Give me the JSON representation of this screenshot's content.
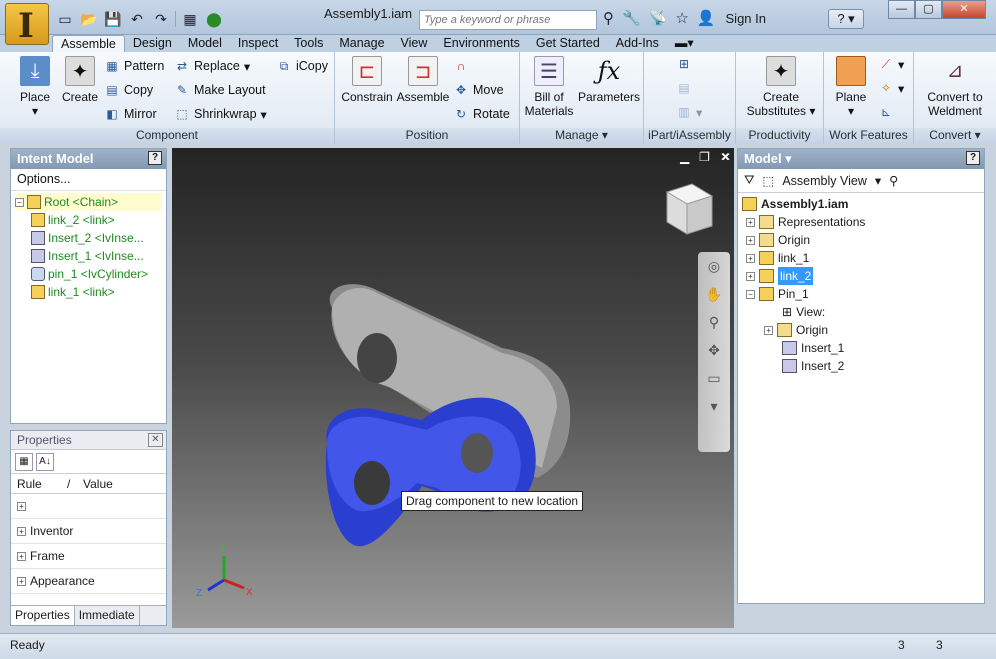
{
  "window": {
    "title": "Assembly1.iam",
    "search_placeholder": "Type a keyword or phrase",
    "sign_in": "Sign In",
    "help": "?"
  },
  "app_button": {
    "letter": "I"
  },
  "tabs": [
    "Assemble",
    "Design",
    "Model",
    "Inspect",
    "Tools",
    "Manage",
    "View",
    "Environments",
    "Get Started",
    "Add-Ins"
  ],
  "ribbon": {
    "component": {
      "label": "Component",
      "place": "Place",
      "create": "Create",
      "pattern": "Pattern",
      "copy": "Copy",
      "mirror": "Mirror",
      "replace": "Replace",
      "make_layout": "Make Layout",
      "shrinkwrap": "Shrinkwrap",
      "icopy": "iCopy"
    },
    "position": {
      "label": "Position",
      "constrain": "Constrain",
      "assemble": "Assemble",
      "move": "Move",
      "rotate": "Rotate"
    },
    "manage": {
      "label": "Manage",
      "bom1": "Bill of",
      "bom2": "Materials",
      "parameters": "Parameters"
    },
    "ipart": {
      "label": "iPart/iAssembly"
    },
    "productivity": {
      "label": "Productivity",
      "create1": "Create",
      "create2": "Substitutes"
    },
    "work_features": {
      "label": "Work Features",
      "plane": "Plane"
    },
    "convert": {
      "label": "Convert",
      "c1": "Convert to",
      "c2": "Weldment"
    }
  },
  "intent_model": {
    "title": "Intent Model",
    "options": "Options...",
    "nodes": [
      "Root <Chain>",
      "link_2 <link>",
      "Insert_2 <IvInse...",
      "Insert_1 <IvInse...",
      "pin_1 <IvCylinder>",
      "link_1 <link>"
    ]
  },
  "properties": {
    "title": "Properties",
    "col_rule": "Rule",
    "col_sep": "/",
    "col_value": "Value",
    "rows": [
      "",
      "Inventor",
      "Frame",
      "Appearance"
    ],
    "tabs": [
      "Properties",
      "Immediate"
    ]
  },
  "viewport": {
    "tooltip": "Drag component to new location",
    "axis_x": "X",
    "axis_y": "Y",
    "axis_z": "Z"
  },
  "model": {
    "title": "Model",
    "view": "Assembly View",
    "root": "Assembly1.iam",
    "nodes": [
      "Representations",
      "Origin",
      "link_1",
      "link_2",
      "Pin_1",
      "View:",
      "Origin",
      "Insert_1",
      "Insert_2"
    ]
  },
  "status": {
    "text": "Ready",
    "n1": "3",
    "n2": "3"
  }
}
